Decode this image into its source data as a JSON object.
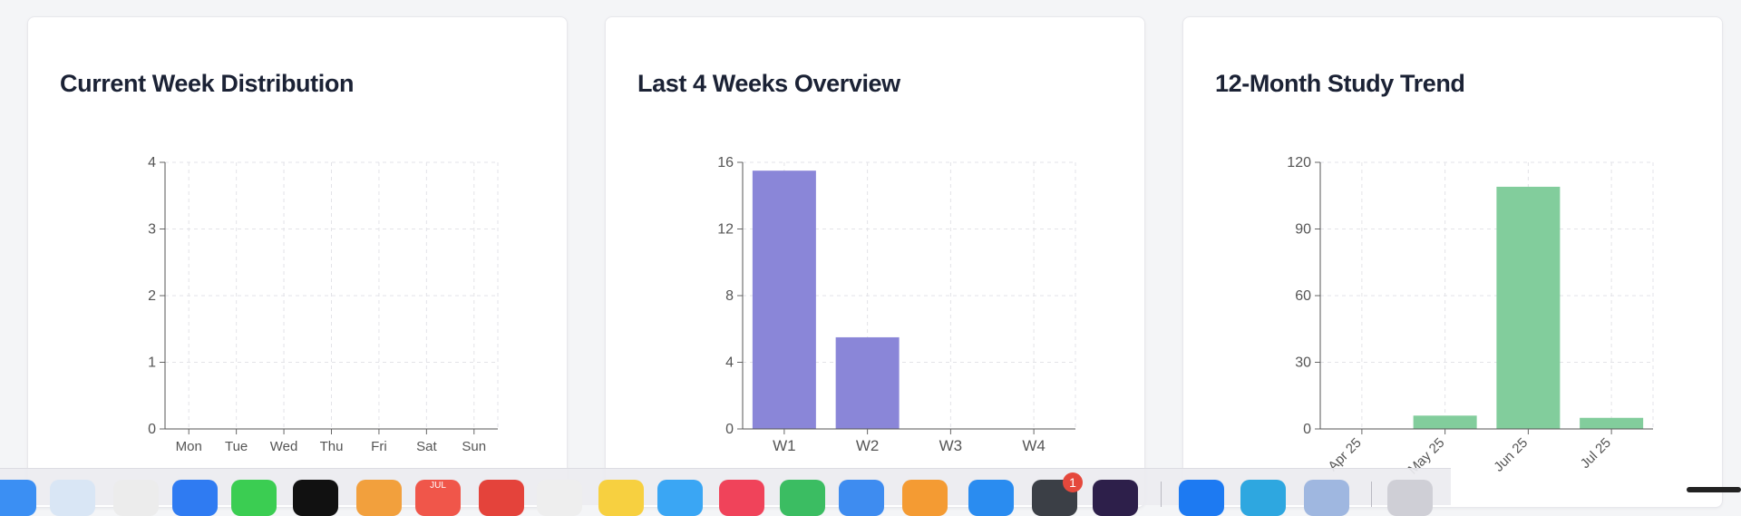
{
  "cards": [
    {
      "title": "Current Week Distribution"
    },
    {
      "title": "Last 4 Weeks Overview"
    },
    {
      "title": "12-Month Study Trend"
    }
  ],
  "chart_data": [
    {
      "type": "bar",
      "title": "Current Week Distribution",
      "categories": [
        "Mon",
        "Tue",
        "Wed",
        "Thu",
        "Fri",
        "Sat",
        "Sun"
      ],
      "values": [
        0,
        0,
        0,
        0,
        0,
        0,
        0
      ],
      "ylim": [
        0,
        4
      ],
      "yticks": [
        0,
        1,
        2,
        3,
        4
      ],
      "grid": true,
      "color": "#8a86d8"
    },
    {
      "type": "bar",
      "title": "Last 4 Weeks Overview",
      "categories": [
        "W1",
        "W2",
        "W3",
        "W4"
      ],
      "values": [
        15.5,
        5.5,
        0,
        0
      ],
      "ylim": [
        0,
        16
      ],
      "yticks": [
        0,
        4,
        8,
        12,
        16
      ],
      "grid": true,
      "color": "#8a86d8"
    },
    {
      "type": "bar",
      "title": "12-Month Study Trend",
      "categories": [
        "Apr 25",
        "May 25",
        "Jun 25",
        "Jul 25"
      ],
      "values": [
        0,
        6,
        109,
        5
      ],
      "ylim": [
        0,
        120
      ],
      "yticks": [
        0,
        30,
        60,
        90,
        120
      ],
      "grid": true,
      "rotated_labels": true,
      "color": "#82cd9c"
    }
  ],
  "dock": {
    "badge_count": "1",
    "calendar_month": "JUL",
    "icons": [
      "finder-icon",
      "safari-icon",
      "launchpad-icon",
      "mail-icon",
      "messages-icon",
      "terminal-icon",
      "photos-icon",
      "calendar-icon",
      "record-icon",
      "contacts-icon",
      "notes-icon",
      "freeform-icon",
      "music-icon",
      "numbers-icon",
      "keynote-icon",
      "pages-icon",
      "app-store-icon",
      "chatgpt-icon",
      "app-icon",
      "app-store-blue-icon",
      "telegram-icon",
      "folder-icon",
      "trash-icon"
    ]
  }
}
